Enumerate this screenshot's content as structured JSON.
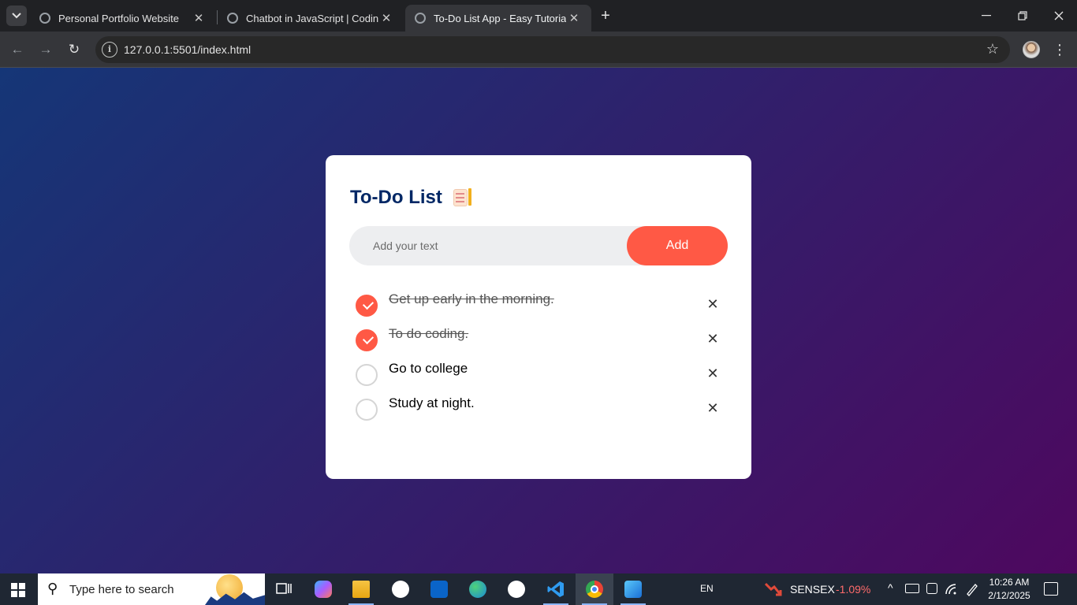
{
  "browser": {
    "tabs": [
      {
        "title": "Personal Portfolio Website",
        "active": false
      },
      {
        "title": "Chatbot in JavaScript | CodingN",
        "active": false
      },
      {
        "title": "To-Do List App - Easy Tutorials",
        "active": true
      }
    ],
    "url": "127.0.0.1:5501/index.html"
  },
  "app": {
    "title": "To-Do List",
    "input_placeholder": "Add your text",
    "add_label": "Add",
    "tasks": [
      {
        "text": "Get up early in the morning.",
        "done": true
      },
      {
        "text": "To do coding.",
        "done": true
      },
      {
        "text": "Go to college",
        "done": false
      },
      {
        "text": "Study at night.",
        "done": false
      }
    ],
    "delete_glyph": "✕"
  },
  "taskbar": {
    "search_placeholder": "Type here to search",
    "language": "EN",
    "stock_name": "SENSEX",
    "stock_change": "-1.09%",
    "time": "10:26 AM",
    "date": "2/12/2025"
  },
  "colors": {
    "accent": "#ff5945",
    "title": "#002765",
    "gradient_start": "#153677",
    "gradient_end": "#4e085f",
    "stock_down": "#ff6b6b"
  },
  "icons": [
    "tab-search-icon",
    "globe-icon",
    "close-icon",
    "plus-icon",
    "back-icon",
    "forward-icon",
    "reload-icon",
    "site-info-icon",
    "star-icon",
    "profile-avatar",
    "more-icon",
    "windows-start-icon",
    "search-icon",
    "task-view-icon",
    "copilot-icon",
    "file-explorer-icon",
    "outlook-icon",
    "edge-icon",
    "github-icon",
    "vscode-icon",
    "chrome-icon",
    "photos-icon"
  ]
}
